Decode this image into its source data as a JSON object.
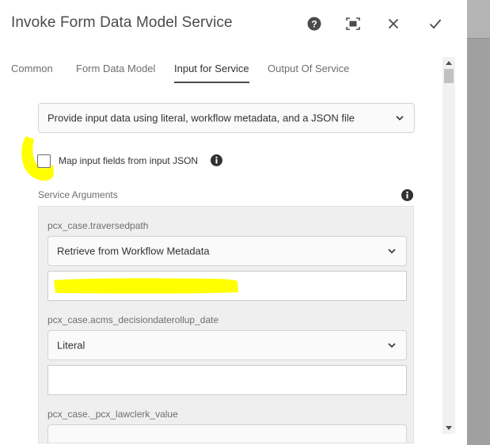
{
  "dialog": {
    "title": "Invoke Form Data Model Service"
  },
  "header_icons": [
    "help-icon",
    "maximize-icon",
    "close-icon",
    "checkmark-icon"
  ],
  "tabs": [
    {
      "label": "Common"
    },
    {
      "label": "Form Data Model"
    },
    {
      "label": "Input for Service",
      "active": true
    },
    {
      "label": "Output Of Service"
    }
  ],
  "input_mode": {
    "selected": "Provide input data using literal, workflow metadata, and a JSON file"
  },
  "map_fields": {
    "label": "Map input fields from input JSON",
    "checked": false
  },
  "service_arguments": {
    "label": "Service Arguments",
    "items": [
      {
        "name": "pcx_case.traversedpath",
        "source": "Retrieve from Workflow Metadata",
        "value": ""
      },
      {
        "name": "pcx_case.acms_decisiondaterollup_date",
        "source": "Literal",
        "value": ""
      },
      {
        "name": "pcx_case._pcx_lawclerk_value",
        "source": "",
        "value": ""
      }
    ]
  },
  "colors": {
    "highlight": "#ffff00",
    "active_tab_underline": "#4b4b4b",
    "panel_bg": "#efefef"
  }
}
